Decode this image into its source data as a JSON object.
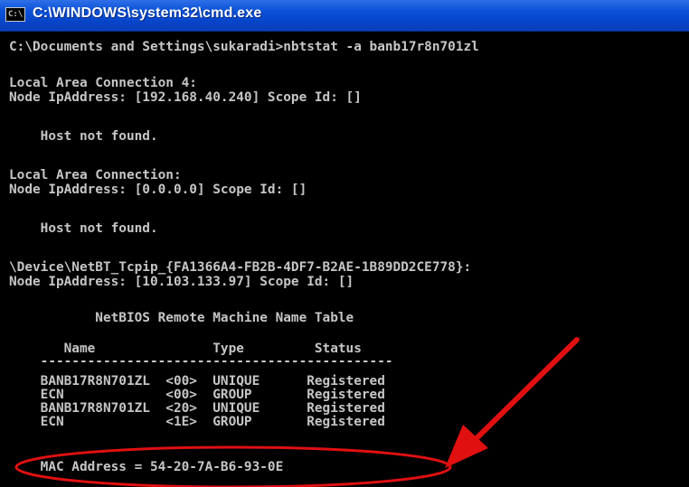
{
  "window": {
    "title": "C:\\WINDOWS\\system32\\cmd.exe",
    "icon_text": "C:\\"
  },
  "console": {
    "command_line": "C:\\Documents and Settings\\sukaradi>nbtstat -a banb17r8n701zl",
    "block1_header": "Local Area Connection 4:",
    "block1_node": "Node IpAddress: [192.168.40.240] Scope Id: []",
    "block1_msg": "    Host not found.",
    "block2_header": "Local Area Connection:",
    "block2_node": "Node IpAddress: [0.0.0.0] Scope Id: []",
    "block2_msg": "    Host not found.",
    "block3_header": "\\Device\\NetBT_Tcpip_{FA1366A4-FB2B-4DF7-B2AE-1B89DD2CE778}:",
    "block3_node": "Node IpAddress: [10.103.133.97] Scope Id: []",
    "table_title": "           NetBIOS Remote Machine Name Table",
    "table_header": "       Name               Type         Status",
    "table_rule": "    ---------------------------------------------",
    "table_rows": [
      "    BANB17R8N701ZL  <00>  UNIQUE      Registered",
      "    ECN             <00>  GROUP       Registered",
      "    BANB17R8N701ZL  <20>  UNIQUE      Registered",
      "    ECN             <1E>  GROUP       Registered"
    ],
    "mac_line": "    MAC Address = 54-20-7A-B6-93-0E"
  },
  "colors": {
    "titlebar": "#0b52d9",
    "console_bg": "#000000",
    "console_text": "#c6c6c6",
    "annotation": "#e01010"
  }
}
